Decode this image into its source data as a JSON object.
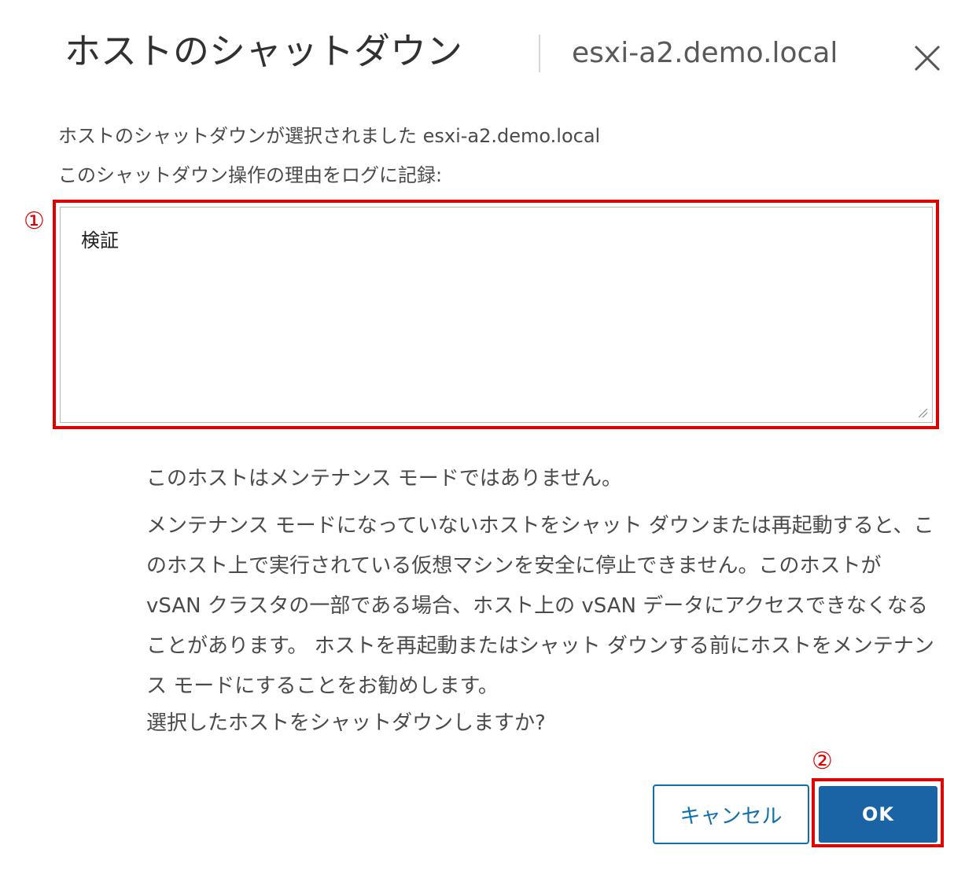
{
  "dialog": {
    "title": "ホストのシャットダウン",
    "subtitle": "esxi-a2.demo.local",
    "close_icon": "close-icon"
  },
  "intro": {
    "line1": "ホストのシャットダウンが選択されました esxi-a2.demo.local",
    "line2": "このシャットダウン操作の理由をログに記録:"
  },
  "reason": {
    "value": "検証"
  },
  "annotations": {
    "marker1": "①",
    "marker2": "②",
    "color": "#e00000"
  },
  "warning": {
    "line1": "このホストはメンテナンス モードではありません。",
    "paragraph": "メンテナンス モードになっていないホストをシャット ダウンまたは再起動すると、このホスト上で実行されている仮想マシンを安全に停止できません。このホストが vSAN クラスタの一部である場合、ホスト上の vSAN データにアクセスできなくなることがあります。 ホストを再起動またはシャット ダウンする前にホストをメンテナンス モードにすることをお勧めします。",
    "question": "選択したホストをシャットダウンしますか?"
  },
  "buttons": {
    "cancel": "キャンセル",
    "ok": "OK"
  },
  "colors": {
    "primary": "#1a64a6",
    "outline": "#0f6fae"
  }
}
